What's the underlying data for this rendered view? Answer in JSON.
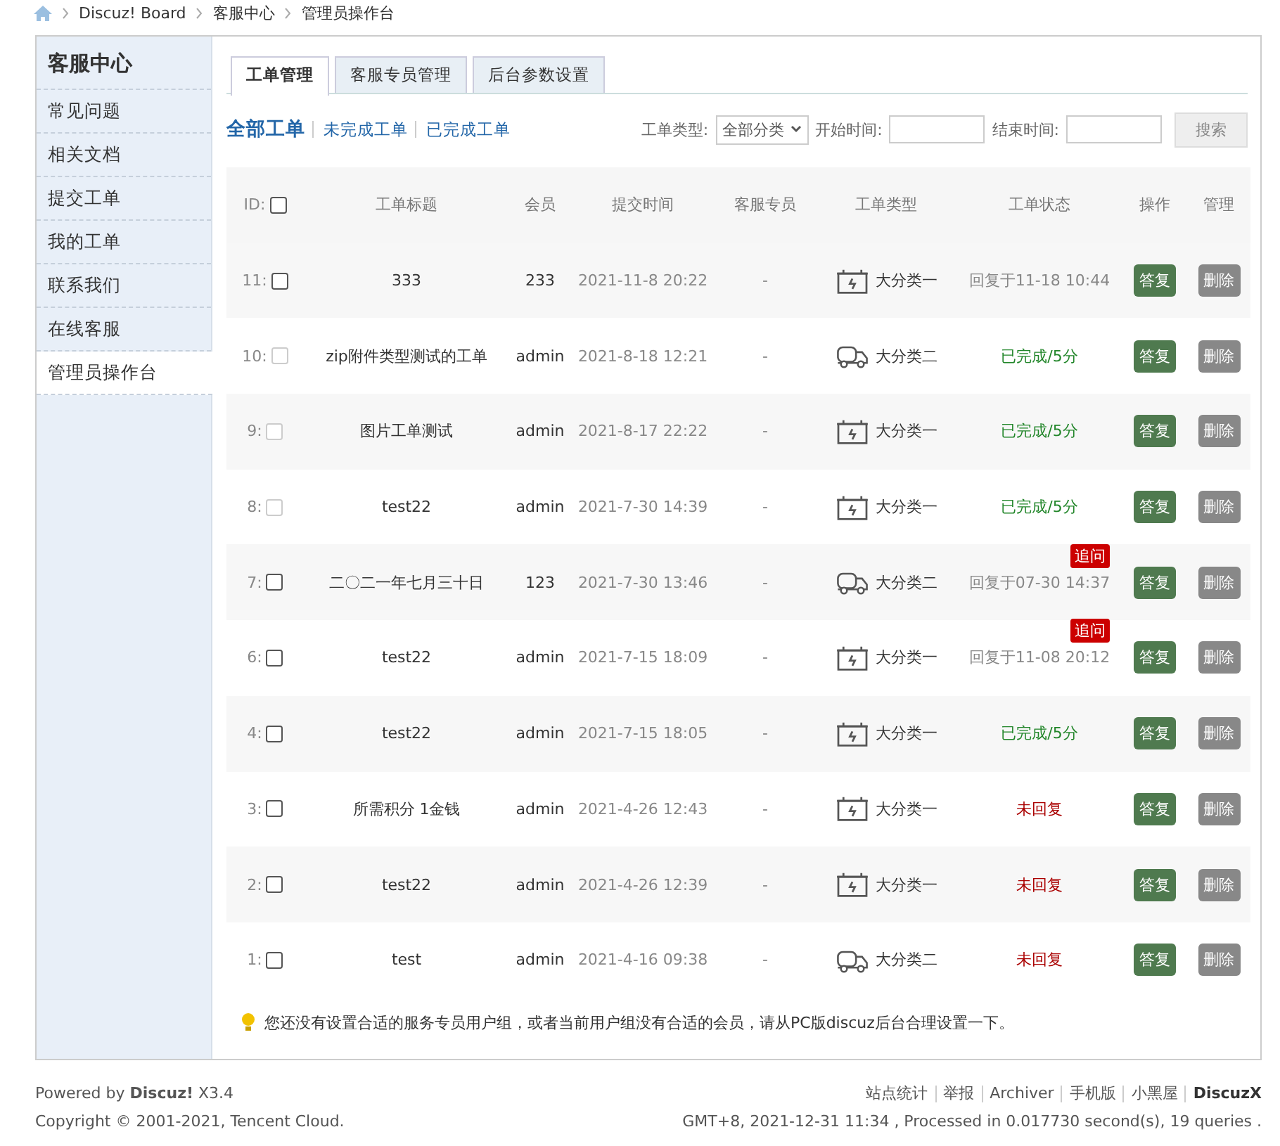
{
  "breadcrumb": [
    "Discuz! Board",
    "客服中心",
    "管理员操作台"
  ],
  "sidebar": {
    "title": "客服中心",
    "items": [
      {
        "label": "常见问题",
        "selected": false
      },
      {
        "label": "相关文档",
        "selected": false
      },
      {
        "label": "提交工单",
        "selected": false
      },
      {
        "label": "我的工单",
        "selected": false
      },
      {
        "label": "联系我们",
        "selected": false
      },
      {
        "label": "在线客服",
        "selected": false
      },
      {
        "label": "管理员操作台",
        "selected": true
      }
    ]
  },
  "tabs": [
    {
      "label": "工单管理",
      "selected": true
    },
    {
      "label": "客服专员管理",
      "selected": false
    },
    {
      "label": "后台参数设置",
      "selected": false
    }
  ],
  "filters": [
    {
      "label": "全部工单",
      "selected": true
    },
    {
      "label": "未完成工单",
      "selected": false
    },
    {
      "label": "已完成工单",
      "selected": false
    }
  ],
  "search": {
    "type_label": "工单类型:",
    "type_value": "全部分类",
    "start_label": "开始时间:",
    "end_label": "结束时间:",
    "button": "搜索"
  },
  "table": {
    "columns": [
      "ID:",
      "工单标题",
      "会员",
      "提交时间",
      "客服专员",
      "工单类型",
      "工单状态",
      "操作",
      "管理"
    ],
    "header_checked": false,
    "rows": [
      {
        "id": "11:",
        "checkbox_disabled": false,
        "title": "333",
        "member": "233",
        "time": "2021-11-8 20:22",
        "agent": "-",
        "type": {
          "kind": "battery",
          "label": "大分类一"
        },
        "status": {
          "kind": "replied",
          "text": "回复于11-18 10:44"
        },
        "action": "答复",
        "manage": "删除"
      },
      {
        "id": "10:",
        "checkbox_disabled": true,
        "title": "zip附件类型测试的工单",
        "member": "admin",
        "time": "2021-8-18 12:21",
        "agent": "-",
        "type": {
          "kind": "truck",
          "label": "大分类二"
        },
        "status": {
          "kind": "done",
          "text": "已完成/5分"
        },
        "action": "答复",
        "manage": "删除"
      },
      {
        "id": "9:",
        "checkbox_disabled": true,
        "title": "图片工单测试",
        "member": "admin",
        "time": "2021-8-17 22:22",
        "agent": "-",
        "type": {
          "kind": "battery",
          "label": "大分类一"
        },
        "status": {
          "kind": "done",
          "text": "已完成/5分"
        },
        "action": "答复",
        "manage": "删除"
      },
      {
        "id": "8:",
        "checkbox_disabled": true,
        "title": "test22",
        "member": "admin",
        "time": "2021-7-30 14:39",
        "agent": "-",
        "type": {
          "kind": "battery",
          "label": "大分类一"
        },
        "status": {
          "kind": "done",
          "text": "已完成/5分"
        },
        "action": "答复",
        "manage": "删除"
      },
      {
        "id": "7:",
        "checkbox_disabled": false,
        "title": "二〇二一年七月三十日",
        "member": "123",
        "time": "2021-7-30 13:46",
        "agent": "-",
        "type": {
          "kind": "truck",
          "label": "大分类二"
        },
        "status": {
          "kind": "replied",
          "text": "回复于07-30 14:37",
          "badge": "追问"
        },
        "action": "答复",
        "manage": "删除"
      },
      {
        "id": "6:",
        "checkbox_disabled": false,
        "title": "test22",
        "member": "admin",
        "time": "2021-7-15 18:09",
        "agent": "-",
        "type": {
          "kind": "battery",
          "label": "大分类一"
        },
        "status": {
          "kind": "replied",
          "text": "回复于11-08 20:12",
          "badge": "追问"
        },
        "action": "答复",
        "manage": "删除"
      },
      {
        "id": "4:",
        "checkbox_disabled": false,
        "title": "test22",
        "member": "admin",
        "time": "2021-7-15 18:05",
        "agent": "-",
        "type": {
          "kind": "battery",
          "label": "大分类一"
        },
        "status": {
          "kind": "done",
          "text": "已完成/5分"
        },
        "action": "答复",
        "manage": "删除"
      },
      {
        "id": "3:",
        "checkbox_disabled": false,
        "title": "所需积分 1金钱",
        "member": "admin",
        "time": "2021-4-26 12:43",
        "agent": "-",
        "type": {
          "kind": "battery",
          "label": "大分类一"
        },
        "status": {
          "kind": "unreplied",
          "text": "未回复"
        },
        "action": "答复",
        "manage": "删除"
      },
      {
        "id": "2:",
        "checkbox_disabled": false,
        "title": "test22",
        "member": "admin",
        "time": "2021-4-26 12:39",
        "agent": "-",
        "type": {
          "kind": "battery",
          "label": "大分类一"
        },
        "status": {
          "kind": "unreplied",
          "text": "未回复"
        },
        "action": "答复",
        "manage": "删除"
      },
      {
        "id": "1:",
        "checkbox_disabled": false,
        "title": "test",
        "member": "admin",
        "time": "2021-4-16 09:38",
        "agent": "-",
        "type": {
          "kind": "truck",
          "label": "大分类二"
        },
        "status": {
          "kind": "unreplied",
          "text": "未回复"
        },
        "action": "答复",
        "manage": "删除"
      }
    ]
  },
  "notice": "您还没有设置合适的服务专员用户组，或者当前用户组没有合适的会员，请从PC版discuz后台合理设置一下。",
  "footer": {
    "powered": "Powered by **Discuz!** X3.4",
    "copyright": "Copyright © 2001-2021, Tencent Cloud.",
    "links": [
      "站点统计",
      "举报",
      "Archiver",
      "手机版",
      "小黑屋"
    ],
    "brand": "DiscuzX",
    "stats": "GMT+8, 2021-12-31 11:34 , Processed in 0.017730 second(s), 19 queries ."
  }
}
